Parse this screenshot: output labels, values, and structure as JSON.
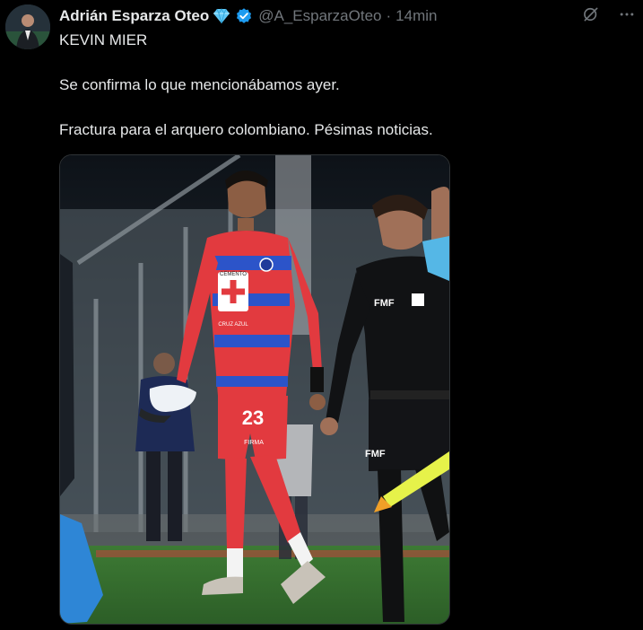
{
  "tweet": {
    "author_name": "Adrián Esparza Oteo",
    "handle": "@A_EsparzaOteo",
    "separator": "·",
    "time": "14min",
    "lines": [
      "KEVIN MIER",
      "Se confirma lo que mencionábamos ayer.",
      "Fractura para el arquero colombiano. Pésimas noticias."
    ],
    "photo": {
      "jersey_text": "CEMENTO",
      "jersey_text2": "CRUZ AZUL",
      "jersey_number": "23",
      "shorts_sponsor": "FIRMA",
      "ref_badge": "FMF",
      "ref_badge_shorts": "FMF"
    }
  },
  "colors": {
    "background": "#000000",
    "text": "#e7e9ea",
    "muted": "#71767b",
    "verified": "#1d9bf0",
    "gem": "#5fc7f5"
  },
  "icons": [
    "diamond-icon",
    "verified-badge-icon",
    "grok-icon",
    "more-icon"
  ]
}
